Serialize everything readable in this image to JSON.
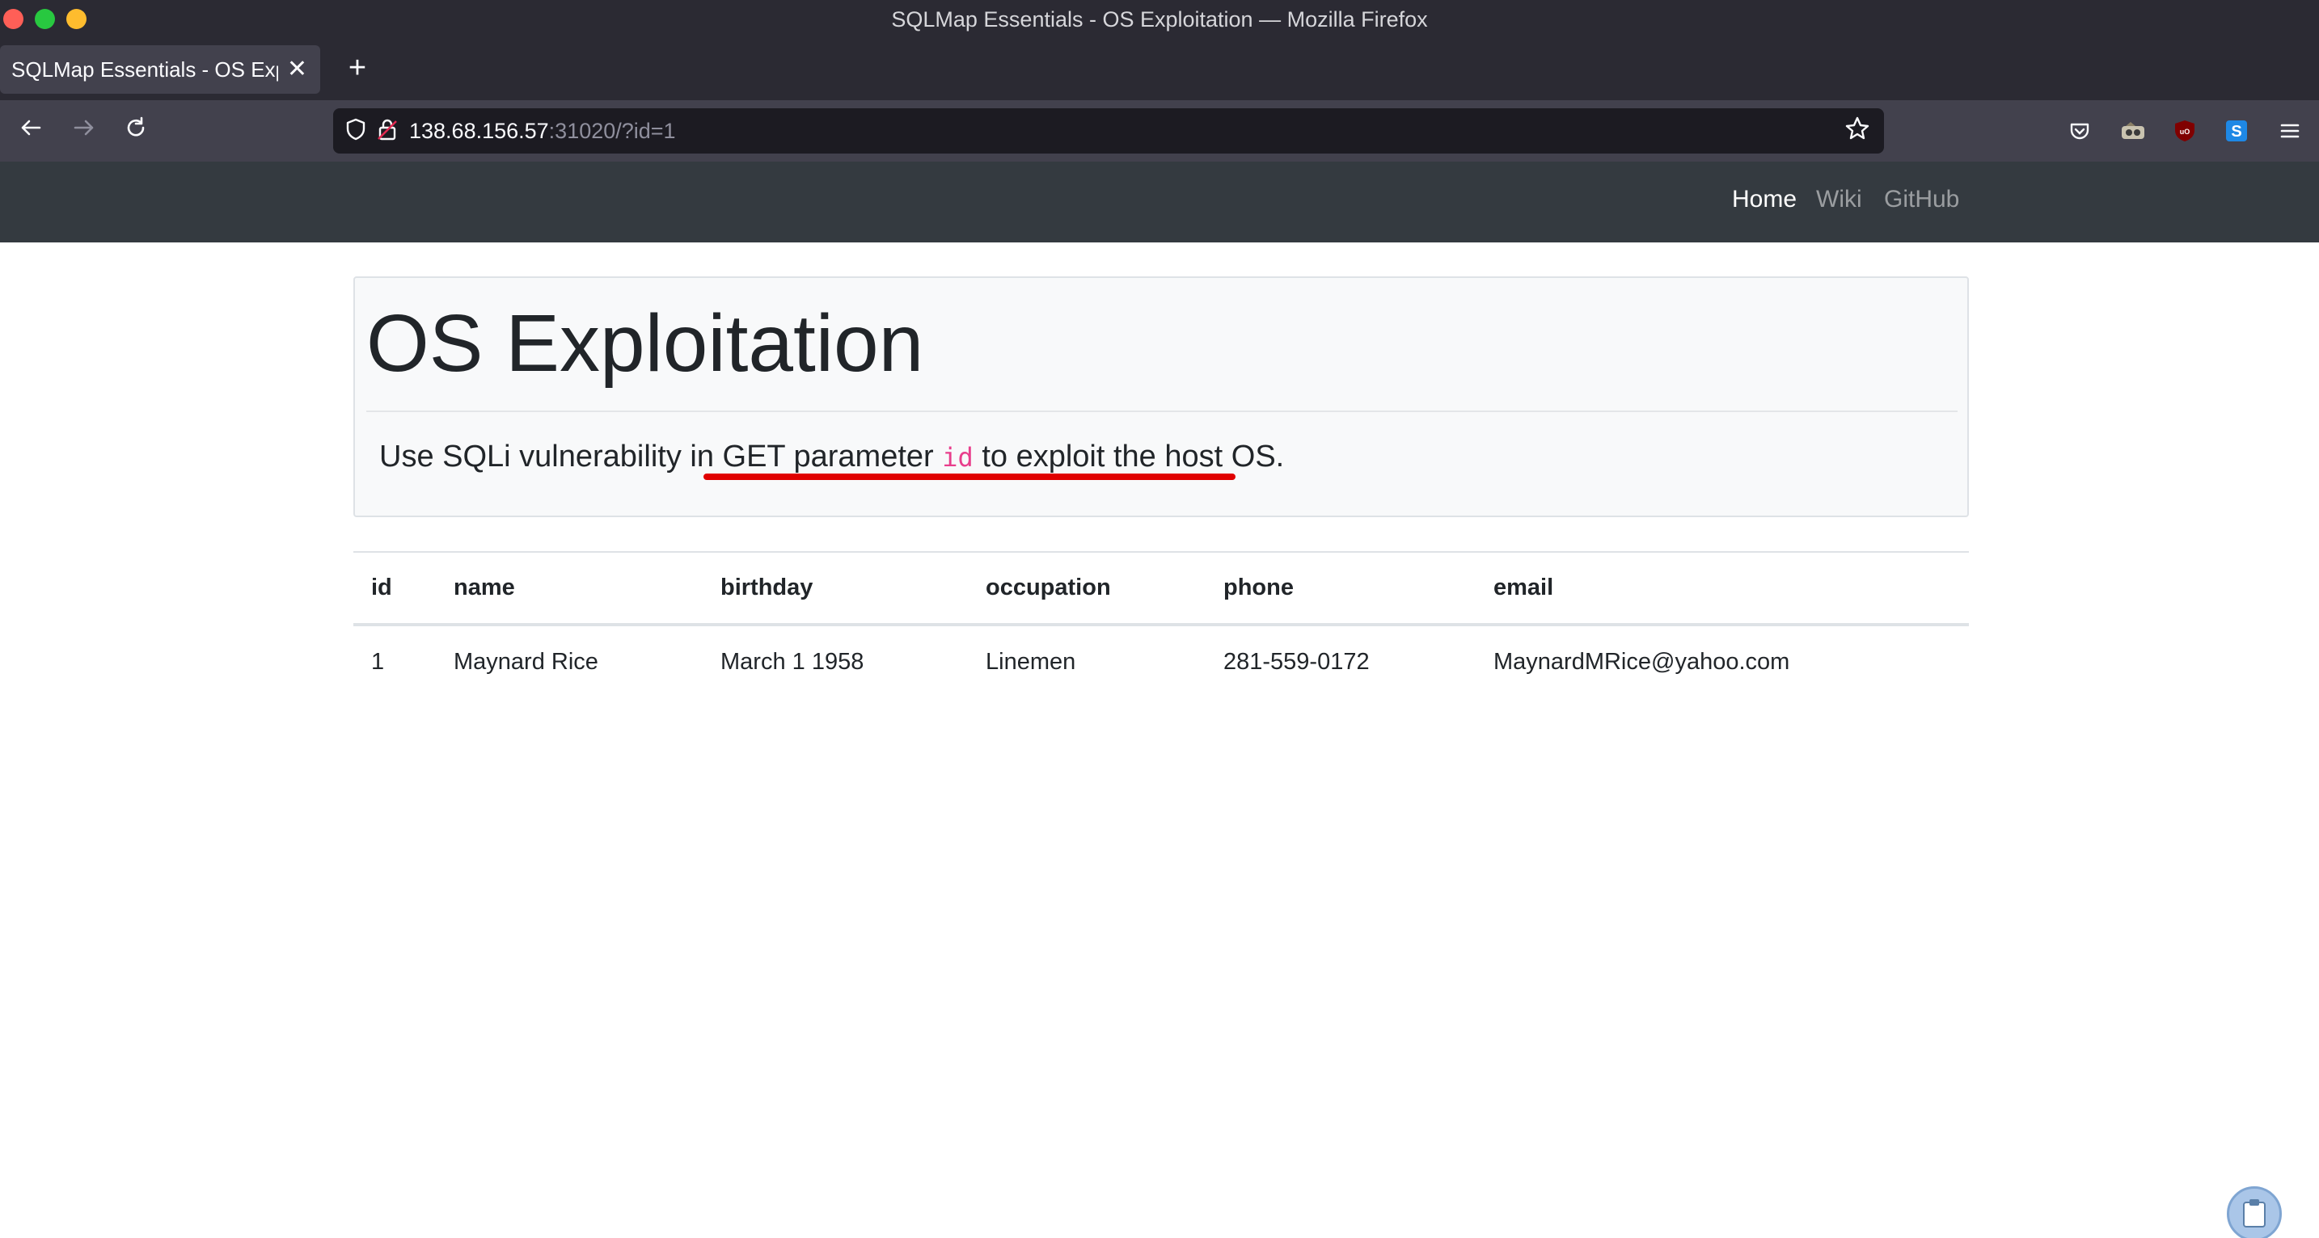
{
  "window": {
    "title": "SQLMap Essentials - OS Exploitation — Mozilla Firefox"
  },
  "tabs": [
    {
      "label": "SQLMap Essentials - OS Expl",
      "active": true
    }
  ],
  "toolbar": {
    "newtab_label": "+",
    "tab_close_label": "✕"
  },
  "urlbar": {
    "host": "138.68.156.57",
    "path": ":31020/?id=1"
  },
  "site_nav": {
    "home": "Home",
    "wiki": "Wiki",
    "github": "GitHub"
  },
  "jumbotron": {
    "heading": "OS Exploitation",
    "lead_prefix": "Use SQLi vulnerability in ",
    "lead_highlight_start": "GET parameter ",
    "lead_code": "id",
    "lead_highlight_end": " to exploit the host OS."
  },
  "table": {
    "columns": [
      "id",
      "name",
      "birthday",
      "occupation",
      "phone",
      "email"
    ],
    "rows": [
      [
        "1",
        "Maynard Rice",
        "March 1 1958",
        "Linemen",
        "281-559-0172",
        "MaynardMRice@yahoo.com"
      ]
    ]
  },
  "colors": {
    "browser_dark": "#2b2a33",
    "browser_toolbar": "#42414d",
    "site_navbar": "#343a40",
    "code_pink": "#e83e8c",
    "highlight_red": "#e00000"
  },
  "icons": [
    "back-arrow-icon",
    "forward-arrow-icon",
    "reload-icon",
    "shield-icon",
    "lock-icon",
    "star-icon",
    "pocket-icon",
    "extension-icon",
    "ublock-icon",
    "s-extension-icon",
    "menu-icon",
    "clipboard-icon"
  ]
}
